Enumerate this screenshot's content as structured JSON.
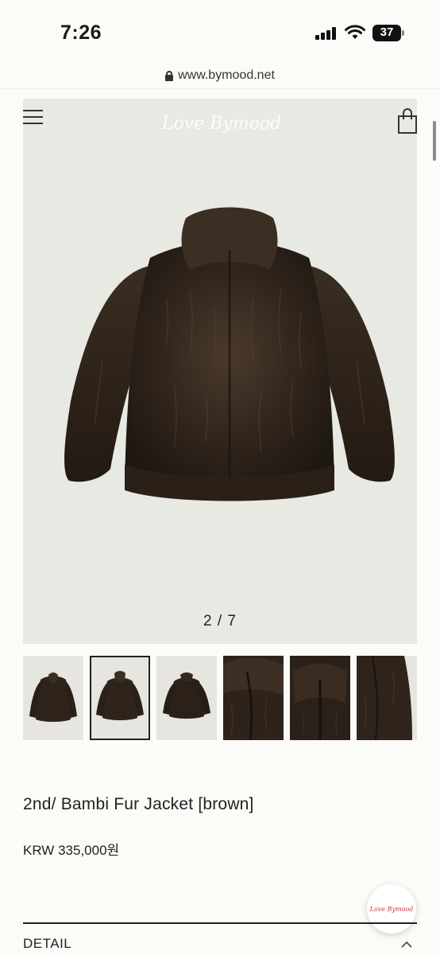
{
  "status_bar": {
    "time": "7:26",
    "battery": "37"
  },
  "browser": {
    "url": "www.bymood.net"
  },
  "header": {
    "logo_text": "Love Bymood"
  },
  "gallery": {
    "pager": "2 / 7",
    "selected_index": 1,
    "thumbnail_count": 6
  },
  "product": {
    "title": "2nd/ Bambi Fur Jacket [brown]",
    "price": "KRW 335,000원"
  },
  "sections": {
    "detail_label": "DETAIL"
  },
  "chat": {
    "logo_text": "Love Bymood"
  },
  "colors": {
    "fur": "#2f241b",
    "background": "#e9e9e4",
    "accent_logo": "#c53a4b"
  }
}
